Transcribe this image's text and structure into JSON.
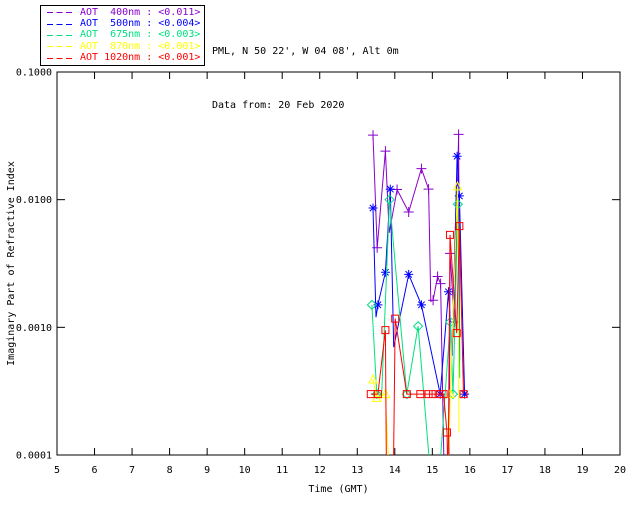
{
  "header": {
    "line1": "PML, N 50 22', W 04 08', Alt 0m",
    "line2": "Data from: 20 Feb 2020"
  },
  "legend": {
    "items": [
      {
        "text": "AOT  400nm : <0.011>",
        "color": "#8800CC"
      },
      {
        "text": "AOT  500nm : <0.004>",
        "color": "#0000FF"
      },
      {
        "text": "AOT  675nm : <0.003>",
        "color": "#00E080"
      },
      {
        "text": "AOT  870nm : <0.001>",
        "color": "#FFFF00"
      },
      {
        "text": "AOT 1020nm : <0.001>",
        "color": "#FF0000"
      }
    ]
  },
  "chart_data": {
    "type": "line",
    "xlabel": "Time (GMT)",
    "ylabel": "Imaginary Part of Refractive Index",
    "xlim": [
      5,
      20
    ],
    "ylim": [
      0.0001,
      0.1
    ],
    "yscale": "log",
    "grid": false,
    "legend_position": "top-left-outside",
    "xticks": [
      5,
      6,
      7,
      8,
      9,
      10,
      11,
      12,
      13,
      14,
      15,
      16,
      17,
      18,
      19,
      20
    ],
    "yticks": [
      {
        "value": 0.1,
        "label": "0.1000"
      },
      {
        "value": 0.01,
        "label": "0.0100"
      },
      {
        "value": 0.001,
        "label": "0.0010"
      },
      {
        "value": 0.0001,
        "label": "0.0001"
      }
    ],
    "series": [
      {
        "name": "AOT 400nm",
        "color": "#8800CC",
        "marker": "plus",
        "points": [
          [
            13.42,
            0.032,
            1
          ],
          [
            13.53,
            0.0042,
            1
          ],
          [
            13.75,
            0.024,
            1
          ],
          [
            13.85,
            0.0055,
            0
          ],
          [
            14.06,
            0.012,
            1
          ],
          [
            14.37,
            0.008,
            1
          ],
          [
            14.71,
            0.0175,
            1
          ],
          [
            14.9,
            0.0121,
            1
          ],
          [
            14.96,
            0.0016,
            0
          ],
          [
            15.02,
            0.00163,
            1
          ],
          [
            15.14,
            0.0025,
            1
          ],
          [
            15.22,
            0.0022,
            1
          ],
          [
            15.32,
            6e-05,
            0
          ],
          [
            15.45,
            6e-05,
            0
          ],
          [
            15.47,
            0.0038,
            1
          ],
          [
            15.59,
            0.0011,
            1
          ],
          [
            15.7,
            0.0325,
            1
          ],
          [
            15.73,
            0.00055,
            0
          ]
        ]
      },
      {
        "name": "AOT 500nm",
        "color": "#0000FF",
        "marker": "asterisk",
        "points": [
          [
            13.42,
            0.0086,
            1
          ],
          [
            13.5,
            0.0012,
            0
          ],
          [
            13.55,
            0.0015,
            1
          ],
          [
            13.75,
            0.0027,
            1
          ],
          [
            13.88,
            0.0121,
            1
          ],
          [
            13.97,
            0.0007,
            0
          ],
          [
            14.37,
            0.0026,
            1
          ],
          [
            14.71,
            0.0015,
            1
          ],
          [
            15.21,
            0.0003,
            1
          ],
          [
            15.43,
            0.0019,
            1
          ],
          [
            15.53,
            0.0006,
            0
          ],
          [
            15.66,
            0.0219,
            1
          ],
          [
            15.72,
            0.0107,
            1
          ],
          [
            15.86,
            0.0003,
            1
          ]
        ]
      },
      {
        "name": "AOT 675nm",
        "color": "#00E080",
        "marker": "diamond",
        "points": [
          [
            13.39,
            0.0015,
            1
          ],
          [
            13.52,
            0.0003,
            1
          ],
          [
            13.65,
            0.0003,
            0
          ],
          [
            13.86,
            0.01,
            1
          ],
          [
            14.32,
            0.0003,
            1
          ],
          [
            14.62,
            0.00102,
            1
          ],
          [
            14.97,
            6e-05,
            0
          ],
          [
            15.17,
            6e-05,
            0
          ],
          [
            15.48,
            0.0011,
            1
          ],
          [
            15.55,
            0.0003,
            1
          ],
          [
            15.68,
            0.0092,
            1
          ],
          [
            15.73,
            0.0004,
            0
          ]
        ]
      },
      {
        "name": "AOT 870nm",
        "color": "#FFFF00",
        "marker": "triangle",
        "points": [
          [
            13.42,
            0.00039,
            1
          ],
          [
            13.52,
            0.00028,
            1
          ],
          [
            13.75,
            0.0003,
            1
          ],
          [
            13.86,
            6e-05,
            0
          ],
          [
            15.42,
            6e-05,
            0
          ],
          [
            15.48,
            0.0003,
            1
          ],
          [
            15.67,
            0.0127,
            1
          ],
          [
            15.71,
            0.00015,
            0
          ]
        ]
      },
      {
        "name": "AOT 1020nm",
        "color": "#FF0000",
        "marker": "square",
        "points": [
          [
            13.36,
            0.0003,
            1
          ],
          [
            13.55,
            0.0003,
            1
          ],
          [
            13.75,
            0.00095,
            1
          ],
          [
            13.78,
            6e-05,
            0
          ],
          [
            13.96,
            6e-05,
            0
          ],
          [
            14.01,
            0.00117,
            1
          ],
          [
            14.32,
            0.0003,
            1
          ],
          [
            14.68,
            0.0003,
            1
          ],
          [
            14.9,
            0.0003,
            1
          ],
          [
            15.02,
            0.0003,
            1
          ],
          [
            15.17,
            0.0003,
            1
          ],
          [
            15.3,
            0.0003,
            1
          ],
          [
            15.39,
            0.00015,
            1
          ],
          [
            15.42,
            6e-05,
            0
          ],
          [
            15.47,
            0.0053,
            1
          ],
          [
            15.65,
            0.0009,
            1
          ],
          [
            15.72,
            0.0062,
            1
          ],
          [
            15.83,
            0.0003,
            1
          ]
        ]
      }
    ]
  }
}
